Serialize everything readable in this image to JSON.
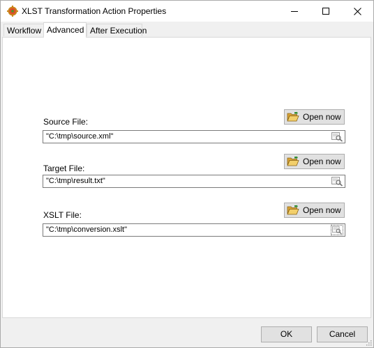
{
  "window": {
    "title": "XLST Transformation Action Properties",
    "icon": "app-gear-icon"
  },
  "tabs": [
    {
      "label": "Workflow",
      "active": false
    },
    {
      "label": "Advanced",
      "active": true
    },
    {
      "label": "After Execution",
      "active": false
    }
  ],
  "fields": {
    "source": {
      "label": "Source File:",
      "value": "\"C:\\tmp\\source.xml\"",
      "open_label": "Open now"
    },
    "target": {
      "label": "Target File:",
      "value": "\"C:\\tmp\\result.txt\"",
      "open_label": "Open now"
    },
    "xslt": {
      "label": "XSLT File:",
      "value": "\"C:\\tmp\\conversion.xslt\"",
      "open_label": "Open now"
    }
  },
  "footer": {
    "ok_label": "OK",
    "cancel_label": "Cancel"
  },
  "colors": {
    "panel_bg": "#ffffff",
    "window_bg": "#f0f0f0",
    "button_bg": "#e1e1e1",
    "button_border": "#adadad",
    "folder_yellow": "#e8b84a"
  }
}
